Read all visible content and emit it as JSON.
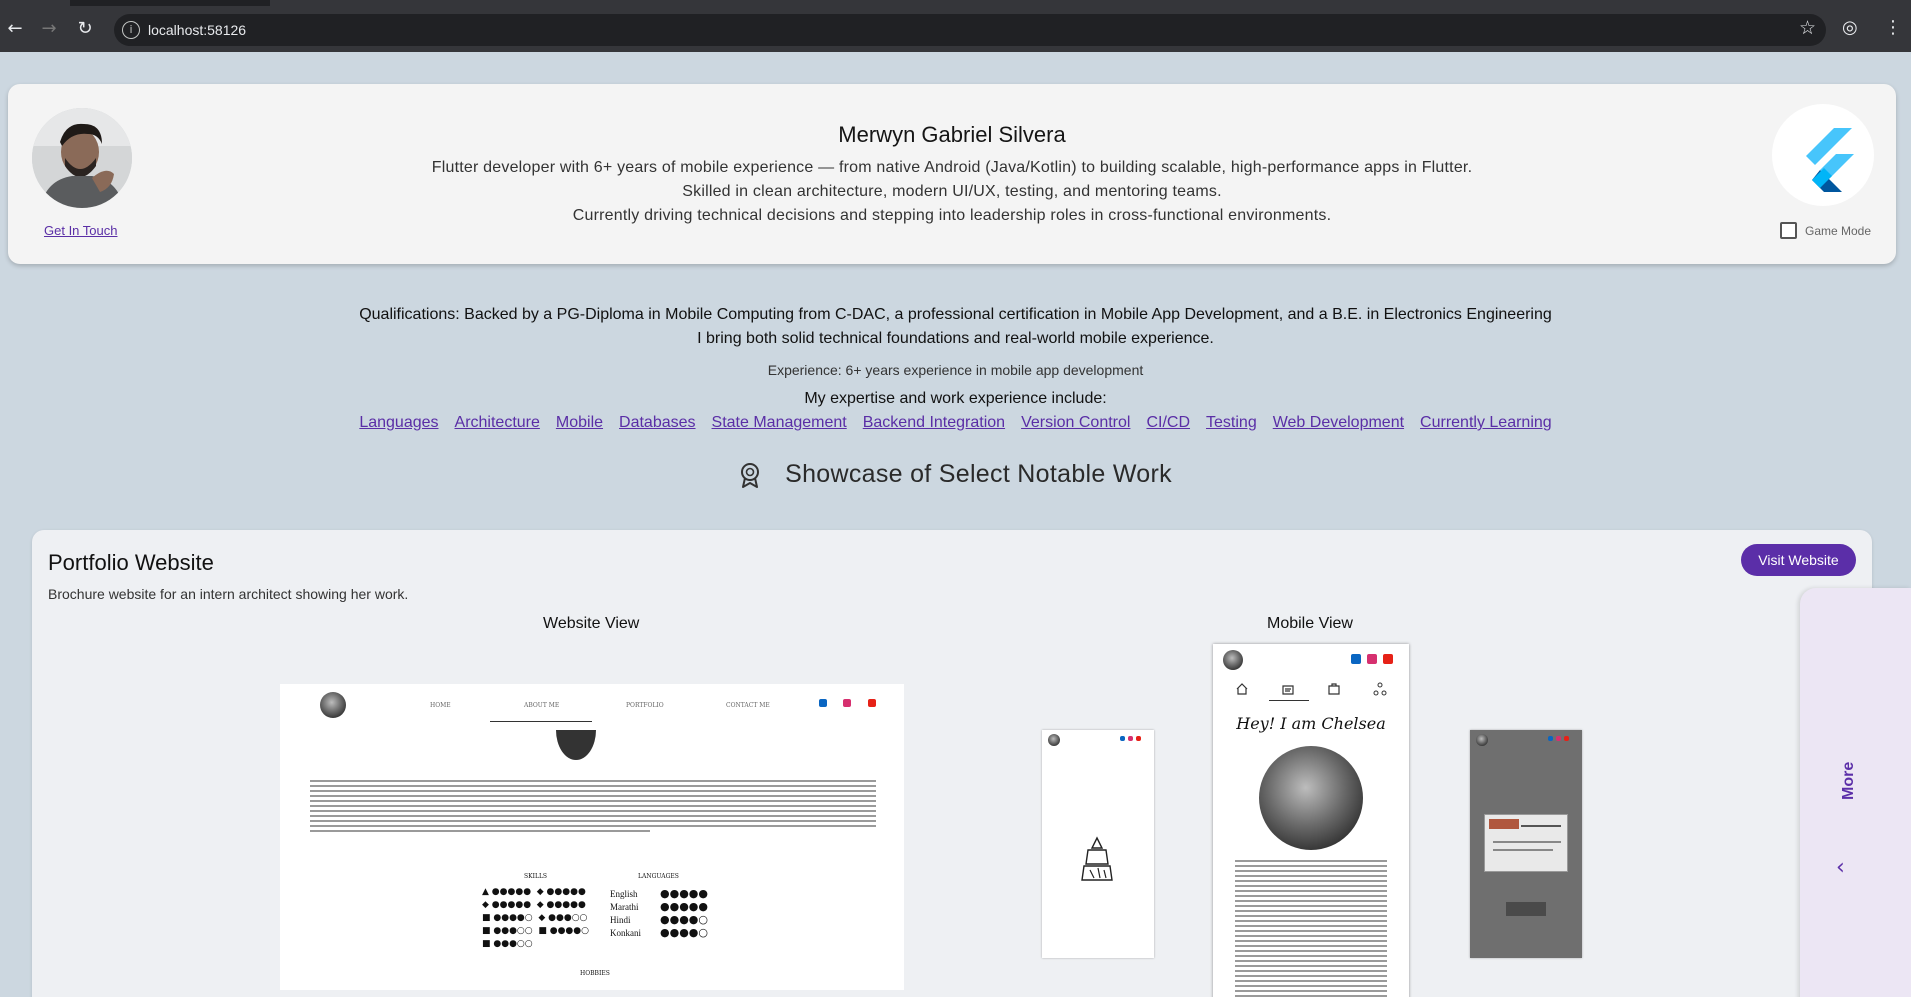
{
  "browser": {
    "url": "localhost:58126",
    "back_icon": "←",
    "forward_icon": "→",
    "reload_icon": "↻",
    "info_icon": "i",
    "star_icon": "☆",
    "profile_icon": "◎",
    "menu_icon": "⋮"
  },
  "header": {
    "name": "Merwyn Gabriel Silvera",
    "summary_lines": [
      "Flutter developer with 6+ years of mobile experience — from native Android (Java/Kotlin) to building scalable, high-performance apps in Flutter.",
      "Skilled in clean architecture, modern UI/UX, testing, and mentoring teams.",
      "Currently driving technical decisions and stepping into leadership roles in cross-functional environments."
    ],
    "get_in_touch": "Get In Touch",
    "game_mode_label": "Game Mode",
    "game_mode_checked": false
  },
  "intro": {
    "qualifications_line1": "Qualifications: Backed by a PG-Diploma in Mobile Computing from C-DAC, a professional certification in Mobile App Development, and a B.E. in Electronics Engineering",
    "qualifications_line2": "I bring both solid technical foundations and real-world mobile experience.",
    "experience": "Experience: 6+ years experience in mobile app development",
    "expertise_label": "My expertise and work experience include:",
    "links": [
      "Languages",
      "Architecture",
      "Mobile",
      "Databases",
      "State Management",
      "Backend Integration",
      "Version Control",
      "CI/CD",
      "Testing",
      "Web Development",
      "Currently Learning"
    ],
    "showcase_title": "Showcase of Select Notable Work"
  },
  "portfolio": {
    "title": "Portfolio Website",
    "description": "Brochure website for an intern architect showing her work.",
    "visit_button": "Visit Website",
    "website_view_label": "Website View",
    "mobile_view_label": "Mobile View",
    "website_shot": {
      "nav": [
        "HOME",
        "ABOUT ME",
        "PORTFOLIO",
        "CONTACT ME"
      ],
      "skills_heading": "SKILLS",
      "languages_heading": "LANGUAGES",
      "hobbies_heading": "HOBBIES",
      "languages": [
        "English",
        "Marathi",
        "Hindi",
        "Konkani"
      ]
    },
    "mobile_shot": {
      "greeting": "Hey! I am Chelsea"
    }
  },
  "drawer": {
    "label": "More",
    "chevron": "‹"
  },
  "colors": {
    "page_bg": "#ccd7e0",
    "accent": "#5b2ea8",
    "link": "#5a2ea6",
    "card_bg": "#f4f4f4",
    "drawer_bg": "#ece6f4"
  }
}
